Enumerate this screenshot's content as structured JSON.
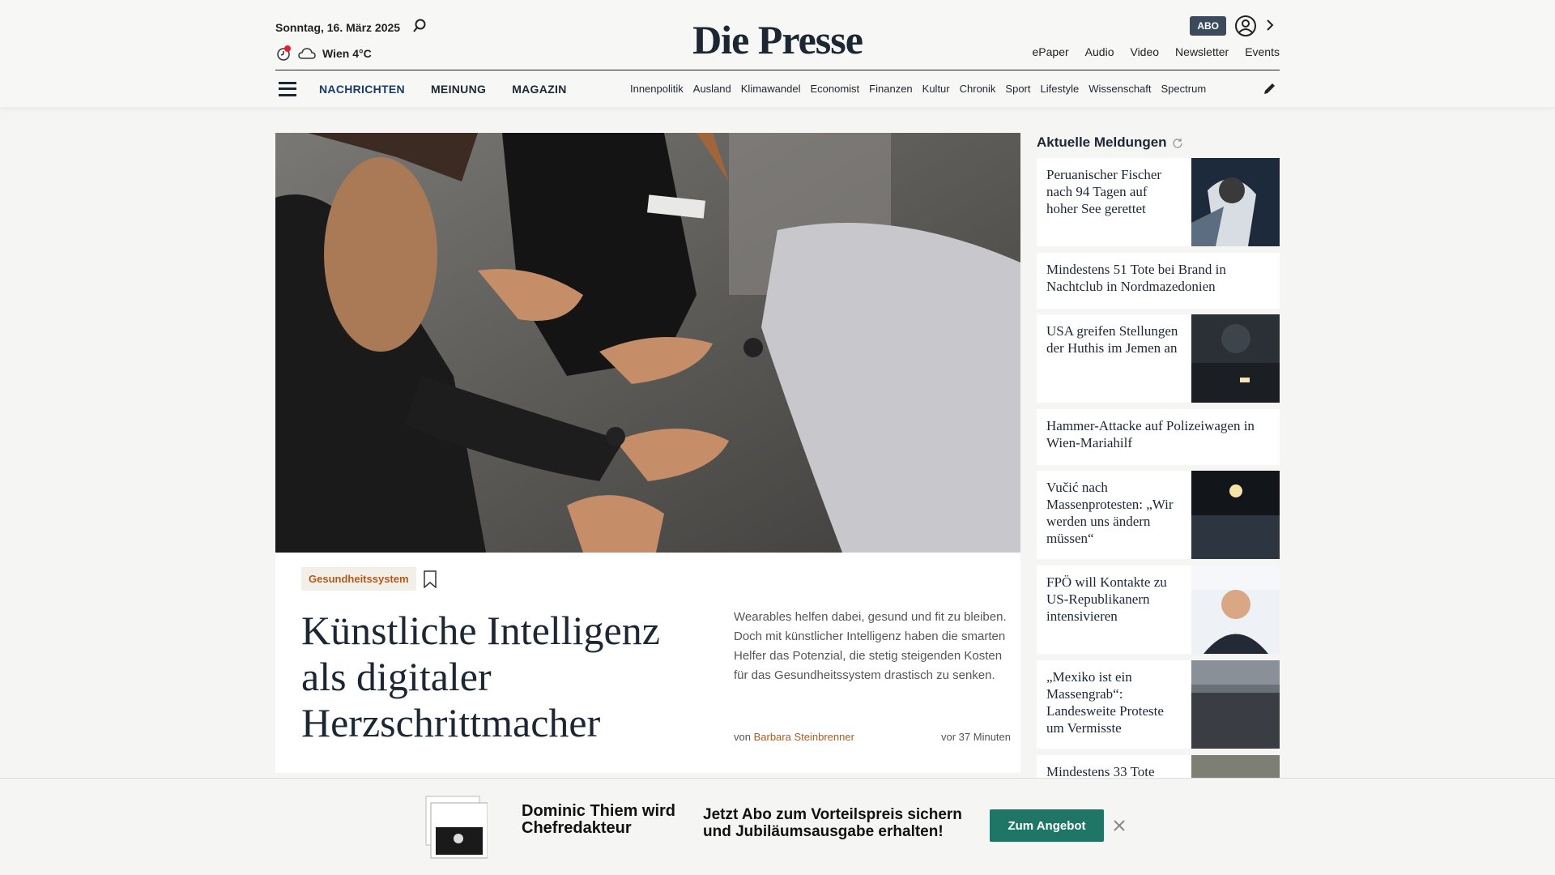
{
  "header": {
    "date": "Sonntag, 16. März 2025",
    "weather": "Wien 4°C",
    "logo": "Die Presse",
    "abo_label": "ABO",
    "service_links": [
      "ePaper",
      "Audio",
      "Video",
      "Newsletter",
      "Events"
    ]
  },
  "nav": {
    "main": [
      "NACHRICHTEN",
      "MEINUNG",
      "MAGAZIN"
    ],
    "sub": [
      "Innenpolitik",
      "Ausland",
      "Klimawandel",
      "Economist",
      "Finanzen",
      "Kultur",
      "Chronik",
      "Sport",
      "Lifestyle",
      "Wissenschaft",
      "Spectrum"
    ]
  },
  "hero": {
    "tag": "Gesundheitssystem",
    "headline": "Künstliche Intelligenz als digitaler Herzschrittmacher",
    "teaser": "Wearables helfen dabei, gesund und fit zu bleiben. Doch mit künstlicher Intelligenz haben die smarten Helfer das Potenzial, die stetig steigenden Kosten für das Gesundheitssystem drastisch zu senken.",
    "byline_prefix": "von",
    "author": "Barbara Steinbrenner",
    "time": "vor 37 Minuten"
  },
  "sidebar": {
    "title": "Aktuelle Meldungen",
    "items": [
      {
        "text": "Peruanischer Fischer nach 94 Tagen auf hoher See gerettet"
      },
      {
        "text": "Mindestens 51 Tote bei Brand in Nachtclub in Nordmazedonien"
      },
      {
        "text": "USA greifen Stellungen der Huthis im Jemen an"
      },
      {
        "text": "Hammer-Attacke auf Polizeiwagen in Wien-Mariahilf"
      },
      {
        "text": "Vučić nach Massenprotesten: „Wir werden uns ändern müssen“"
      },
      {
        "text": "FPÖ will Kontakte zu US-Republikanern intensivieren"
      },
      {
        "text": "„Mexiko ist ein Massengrab“: Landesweite Proteste um Vermisste"
      },
      {
        "text": "Mindestens 33 Tote"
      }
    ]
  },
  "banner": {
    "title": "Dominic Thiem wird Chefredakteur",
    "text": "Jetzt Abo zum Vorteilspreis sichern und Jubiläumsausgabe erhalten!",
    "button": "Zum Angebot"
  },
  "colors": {
    "brand_navy": "#1d2733",
    "accent_orange": "#b05a1a",
    "cta_green": "#1f7566"
  }
}
